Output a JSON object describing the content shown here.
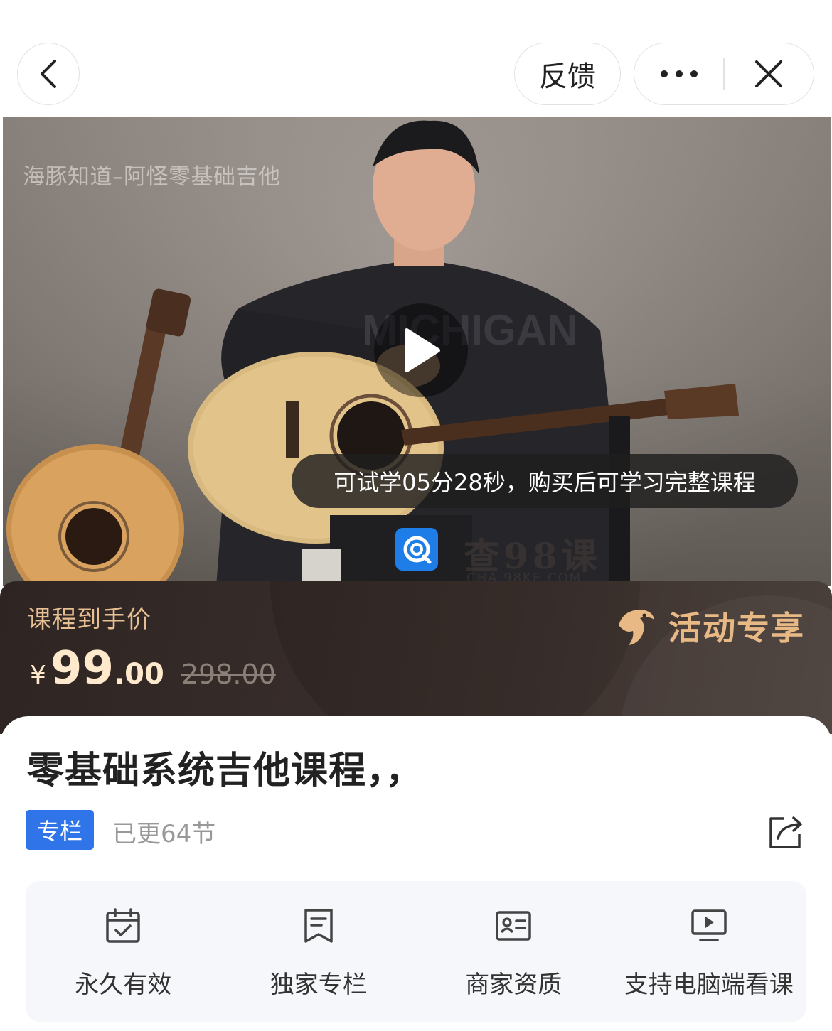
{
  "topbar": {
    "back_icon": "chevron-left-icon",
    "feedback_label": "反馈",
    "more_icon": "more-dots-icon",
    "close_icon": "close-icon"
  },
  "video": {
    "watermark": "海豚知道–阿怪零基础吉他",
    "play_icon": "play-icon",
    "trial_tip": "可试学05分28秒，购买后可学习完整课程",
    "brand_watermark": {
      "title": "查98课",
      "subtitle": "CHA 98KE.COM"
    }
  },
  "promo": {
    "price_label": "课程到手价",
    "currency": "¥",
    "price_int": "99",
    "price_dec": ".00",
    "original_price": "298.00",
    "tag_label": "活动专享",
    "colors": {
      "gold": "#e8b985",
      "background": "#2e2523"
    }
  },
  "course": {
    "title": "零基础系统吉他课程，，",
    "type_badge": "专栏",
    "update_count": "已更64节",
    "share_icon": "share-icon"
  },
  "features": [
    {
      "icon": "calendar-check-icon",
      "label": "永久有效"
    },
    {
      "icon": "bookmark-doc-icon",
      "label": "独家专栏"
    },
    {
      "icon": "id-card-icon",
      "label": "商家资质"
    },
    {
      "icon": "monitor-play-icon",
      "label": "支持电脑端看课"
    }
  ],
  "accent": "#2f74e8"
}
